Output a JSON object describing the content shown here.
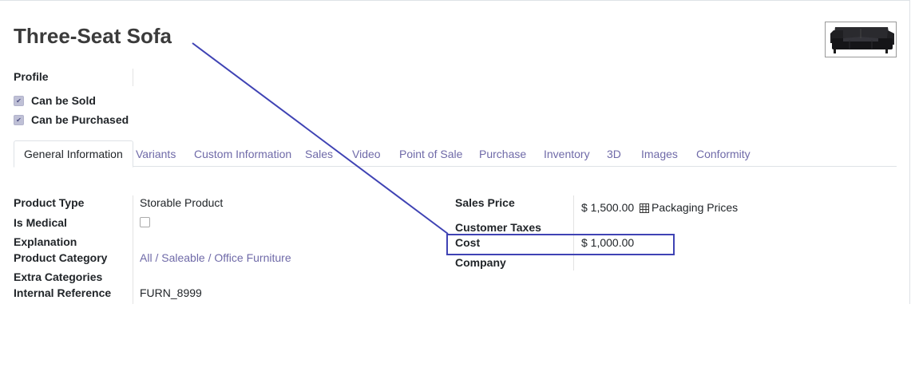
{
  "product": {
    "name": "Three-Seat Sofa",
    "profile_label": "Profile",
    "can_be_sold_label": "Can be Sold",
    "can_be_sold": true,
    "can_be_purchased_label": "Can be Purchased",
    "can_be_purchased": true
  },
  "tabs": [
    {
      "label": "General Information",
      "active": true
    },
    {
      "label": "Variants"
    },
    {
      "label": "Custom Information"
    },
    {
      "label": "Sales"
    },
    {
      "label": "Video"
    },
    {
      "label": "Point of Sale"
    },
    {
      "label": "Purchase"
    },
    {
      "label": "Inventory"
    },
    {
      "label": "3D"
    },
    {
      "label": "Images"
    },
    {
      "label": "Conformity"
    }
  ],
  "general": {
    "product_type_label": "Product Type",
    "product_type": "Storable Product",
    "is_medical_label": "Is Medical",
    "is_medical": false,
    "explanation_label": "Explanation",
    "product_category_label": "Product Category",
    "product_category": "All / Saleable / Office Furniture",
    "extra_categories_label": "Extra Categories",
    "internal_reference_label": "Internal Reference",
    "internal_reference": "FURN_8999"
  },
  "pricing": {
    "sales_price_label": "Sales Price",
    "sales_price": "$ 1,500.00",
    "packaging_prices_label": "Packaging Prices",
    "customer_taxes_label": "Customer Taxes",
    "cost_label": "Cost",
    "cost": "$ 1,000.00",
    "company_label": "Company"
  },
  "annotation_color": "#3f43b4",
  "link_color": "#6f6aa8",
  "icons": {
    "product_image": "sofa-image",
    "packaging": "table-grid-icon",
    "checkbox": "checkmark-icon"
  }
}
